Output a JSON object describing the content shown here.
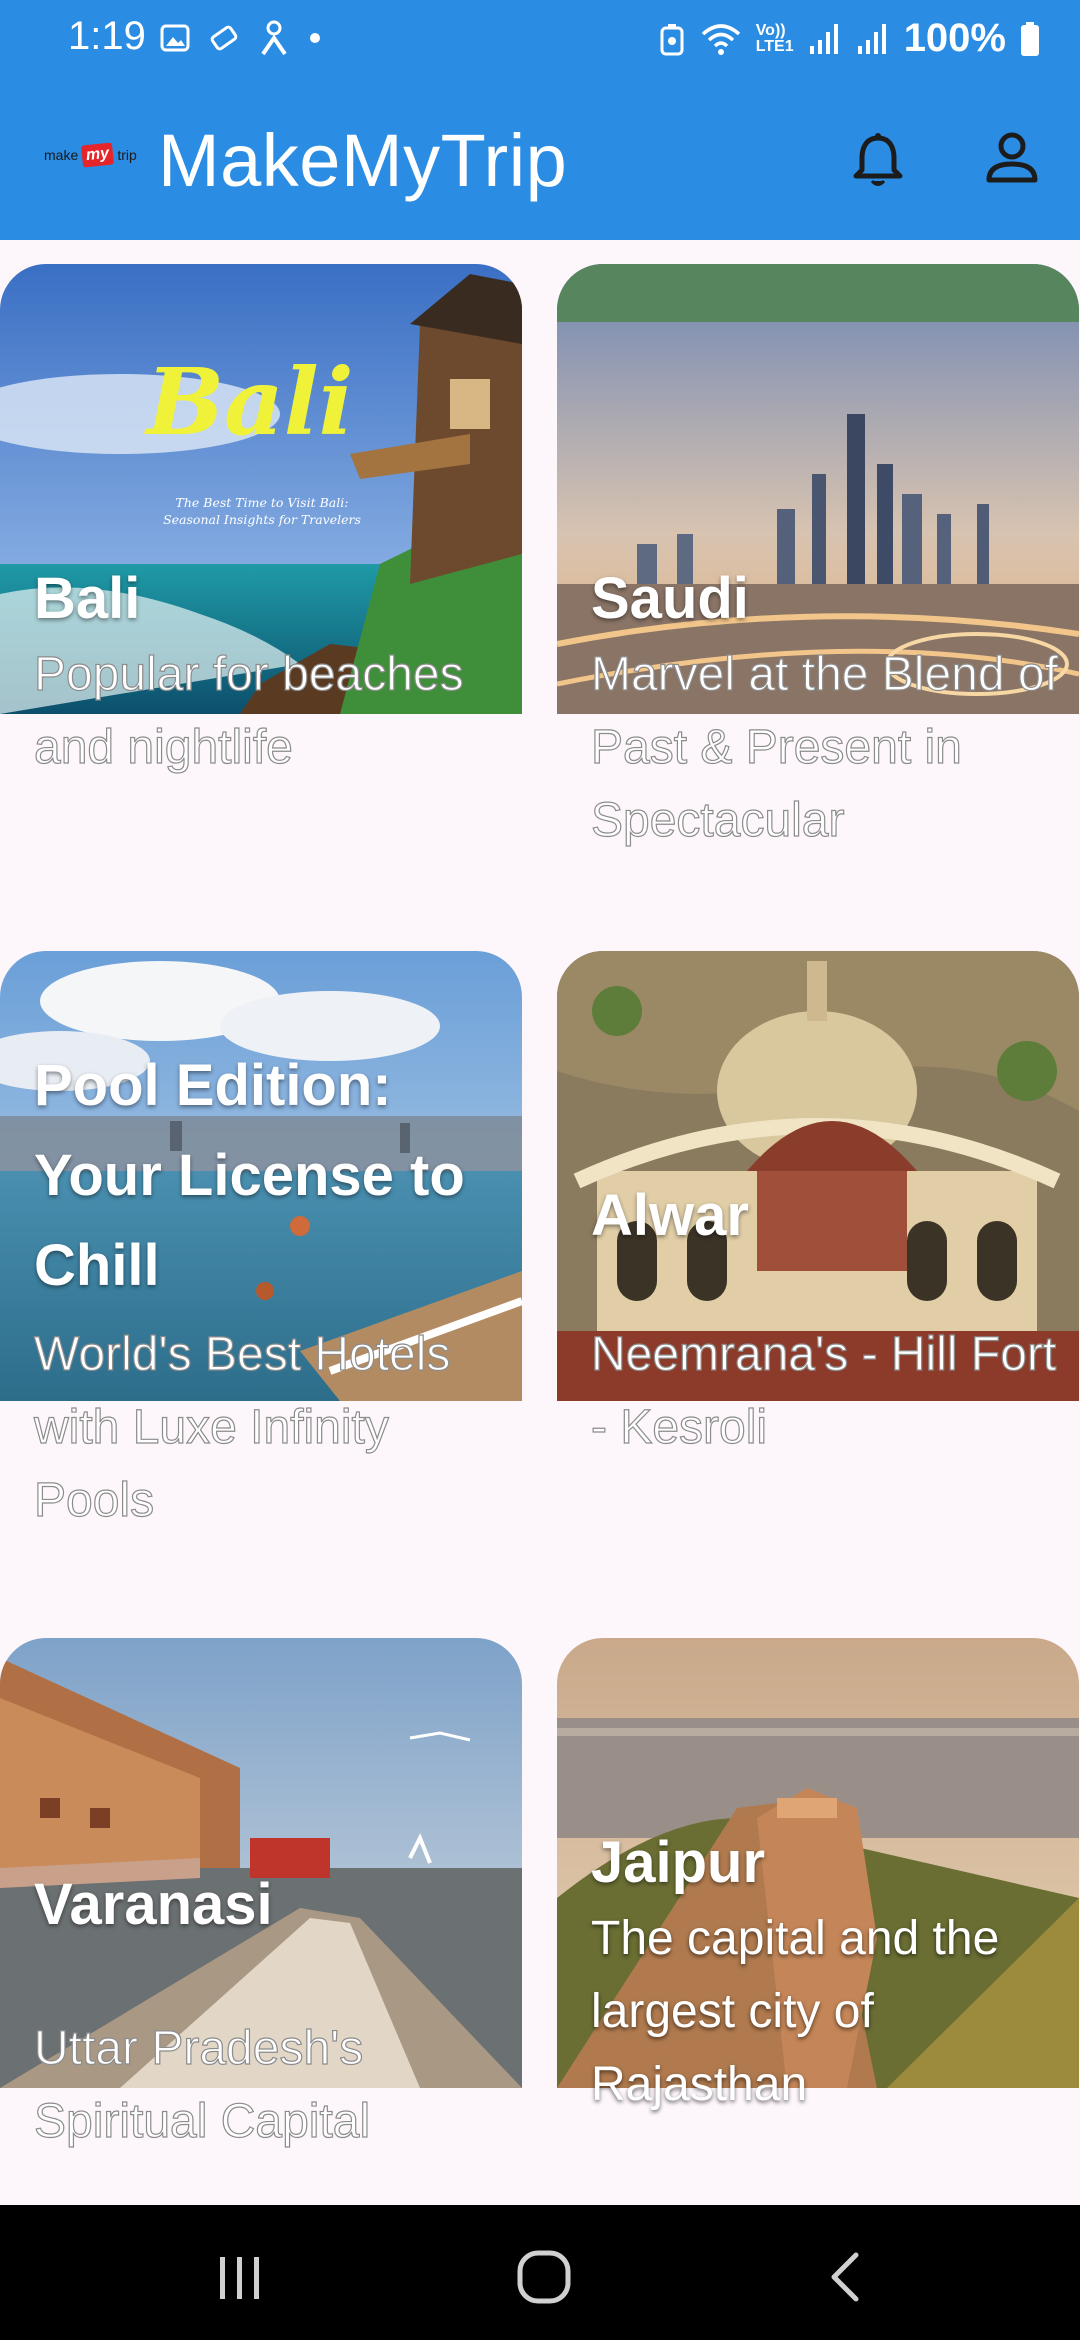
{
  "status_bar": {
    "time": "1:19",
    "battery": "100%",
    "network": "Vo)) LTE1"
  },
  "app_bar": {
    "logo_left": "make",
    "logo_mid": "my",
    "logo_right": "trip",
    "title": "MakeMyTrip",
    "icons": [
      "bell-icon",
      "account-icon"
    ]
  },
  "cards": [
    {
      "title": "Bali",
      "description": "Popular for beaches and nightlife",
      "image_text": "Bali",
      "image_subtext": "The Best Time to Visit Bali: Seasonal Insights for Travelers"
    },
    {
      "title": "Saudi",
      "description": "Marvel at the Blend of Past & Present in Spectacular"
    },
    {
      "title": "Pool Edition: Your License to Chill",
      "description": "World's Best Hotels with Luxe Infinity Pools"
    },
    {
      "title": "Alwar",
      "description": "Neemrana's - Hill Fort - Kesroli"
    },
    {
      "title": "Varanasi",
      "description": "Uttar Pradesh's Spiritual Capital"
    },
    {
      "title": "Jaipur",
      "description": "The capital and the largest city of Rajasthan"
    }
  ],
  "nav_bar": {
    "icons": [
      "recent-apps-icon",
      "home-icon",
      "back-icon"
    ]
  },
  "colors": {
    "brand_blue": "#2b8ce4",
    "background": "#fdf6fb",
    "logo_red": "#e5252a"
  }
}
